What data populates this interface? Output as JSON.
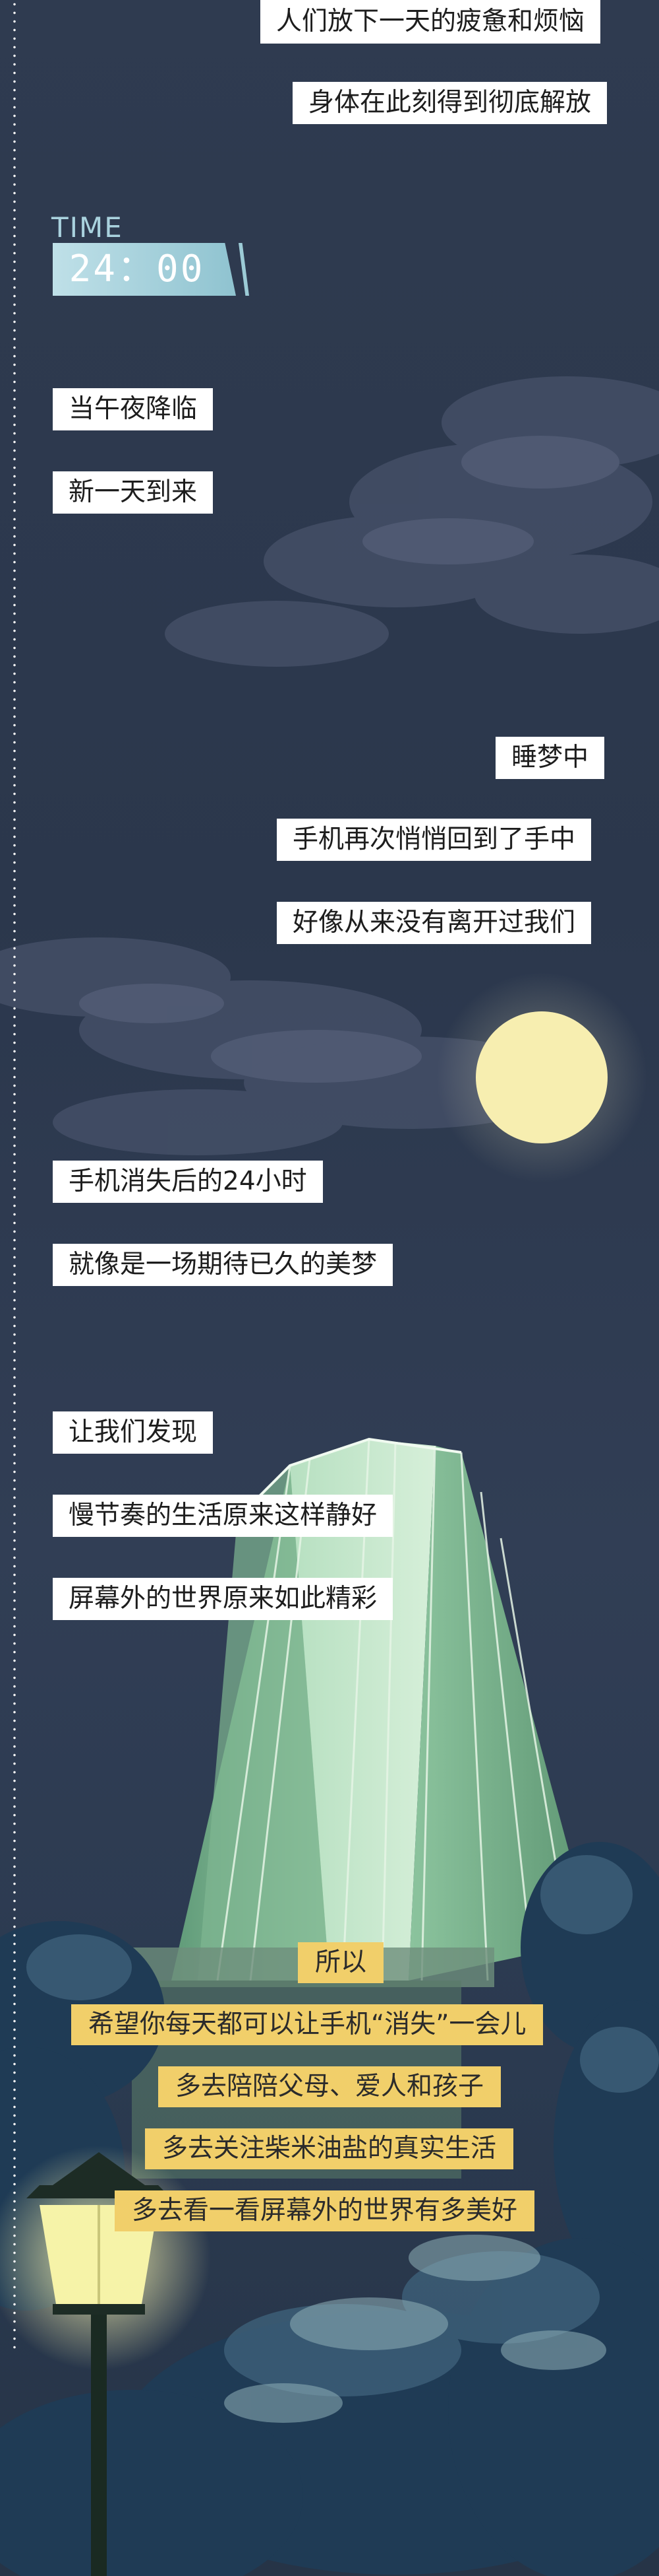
{
  "time": {
    "label": "TIME",
    "value": "24：00"
  },
  "captions": {
    "c1": "人们放下一天的疲惫和烦恼",
    "c2": "身体在此刻得到彻底解放",
    "c3": "当午夜降临",
    "c4": "新一天到来",
    "c5": "睡梦中",
    "c6": "手机再次悄悄回到了手中",
    "c7": "好像从来没有离开过我们",
    "c8": "手机消失后的24小时",
    "c9": "就像是一场期待已久的美梦",
    "c10": "让我们发现",
    "c11": "慢节奏的生活原来这样静好",
    "c12": "屏幕外的世界原来如此精彩"
  },
  "closing": {
    "y1": "所以",
    "y2": "希望你每天都可以让手机“消失”一会儿",
    "y3": "多去陪陪父母、爱人和孩子",
    "y4": "多去关注柴米油盐的真实生活",
    "y5": "多去看一看屏幕外的世界有多美好"
  },
  "colors": {
    "background": "#2e3a4f",
    "caption_bg": "#ffffff",
    "closing_bg": "#f1cf6a",
    "moon": "#f7eeb0",
    "building": "#9ed0a8"
  }
}
